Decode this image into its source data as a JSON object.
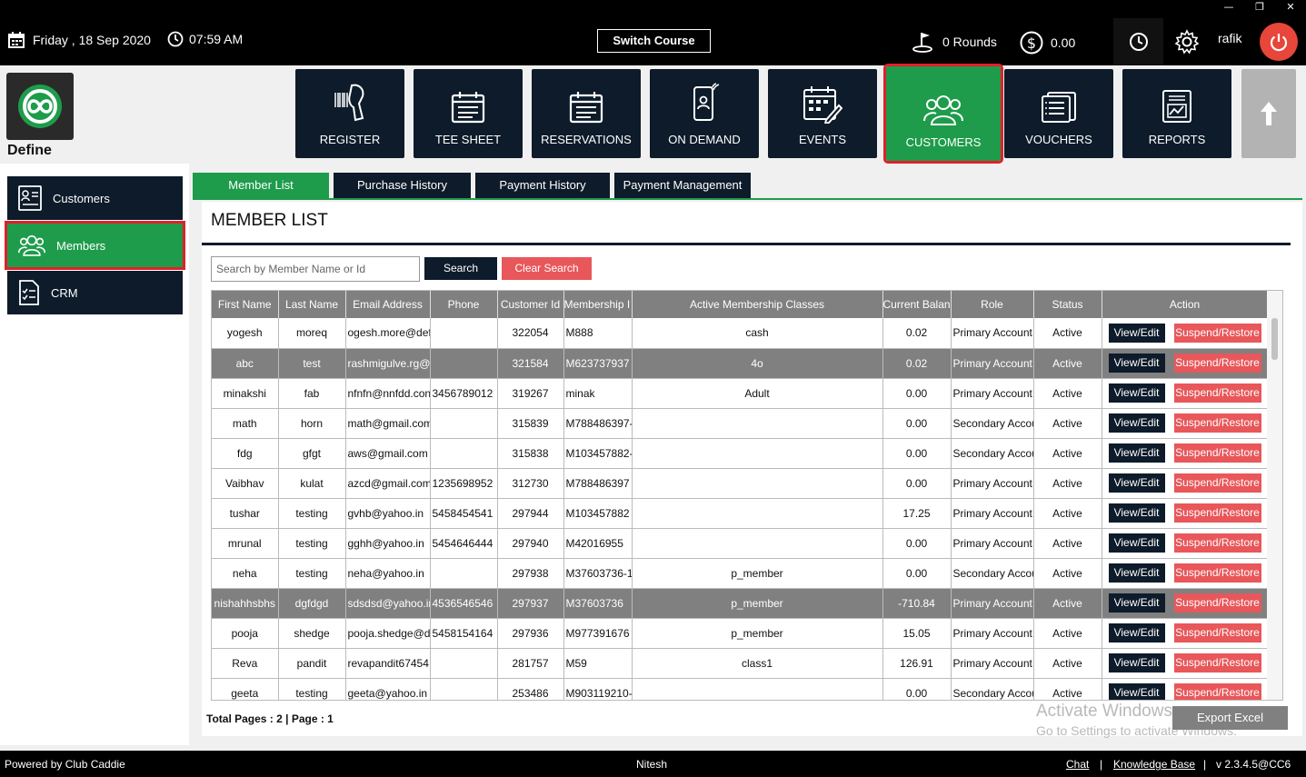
{
  "window_controls": [
    "—",
    "❐",
    "✕"
  ],
  "topbar": {
    "date": "Friday ,  18 Sep 2020",
    "time": "07:59 AM",
    "switch_course": "Switch Course",
    "rounds": "0 Rounds",
    "balance": "0.00",
    "user": "rafik"
  },
  "logo": {
    "label": "Define"
  },
  "nav": [
    {
      "label": "REGISTER",
      "icon": "barcode-scanner-icon"
    },
    {
      "label": "TEE SHEET",
      "icon": "calendar-icon"
    },
    {
      "label": "RESERVATIONS",
      "icon": "calendar-icon"
    },
    {
      "label": "ON DEMAND",
      "icon": "mobile-icon"
    },
    {
      "label": "EVENTS",
      "icon": "calendar-edit-icon"
    },
    {
      "label": "CUSTOMERS",
      "icon": "users-icon",
      "active": true
    },
    {
      "label": "VOUCHERS",
      "icon": "voucher-icon"
    },
    {
      "label": "REPORTS",
      "icon": "report-icon"
    }
  ],
  "sidebar": {
    "items": [
      {
        "label": "Customers",
        "icon": "id-card-icon"
      },
      {
        "label": "Members",
        "icon": "users-icon",
        "active": true
      },
      {
        "label": "CRM",
        "icon": "checklist-icon"
      }
    ]
  },
  "tabs": [
    {
      "label": "Member List",
      "active": true
    },
    {
      "label": "Purchase History"
    },
    {
      "label": "Payment History"
    },
    {
      "label": "Payment Management"
    }
  ],
  "page_title": "MEMBER LIST",
  "search": {
    "placeholder": "Search by Member Name or Id",
    "search_label": "Search",
    "clear_label": "Clear Search"
  },
  "table": {
    "columns": [
      "First Name",
      "Last Name",
      "Email Address",
      "Phone",
      "Customer Id",
      "Membership I",
      "Active Membership Classes",
      "Current Balan",
      "Role",
      "Status",
      "Action"
    ],
    "view_label": "View/Edit",
    "suspend_label": "Suspend/Restore",
    "rows": [
      {
        "first": "yogesh",
        "last": "moreq",
        "email": "ogesh.more@def",
        "phone": "",
        "id": "322054",
        "membership": "M888",
        "classes": "cash",
        "balance": "0.02",
        "role": "Primary Account",
        "status": "Active"
      },
      {
        "first": "abc",
        "last": "test",
        "email": "rashmigulve.rg@",
        "phone": "",
        "id": "321584",
        "membership": "M623737937",
        "classes": "4o",
        "balance": "0.02",
        "role": "Primary Account",
        "status": "Active",
        "selected": true
      },
      {
        "first": "minakshi",
        "last": "fab",
        "email": "nfnfn@nnfdd.con",
        "phone": "3456789012",
        "id": "319267",
        "membership": "minak",
        "classes": "Adult",
        "balance": "0.00",
        "role": "Primary Account",
        "status": "Active"
      },
      {
        "first": "math",
        "last": "horn",
        "email": "math@gmail.com",
        "phone": "",
        "id": "315839",
        "membership": "M788486397-",
        "classes": "",
        "balance": "0.00",
        "role": "Secondary Accou",
        "status": "Active"
      },
      {
        "first": "fdg",
        "last": "gfgt",
        "email": "aws@gmail.com",
        "phone": "",
        "id": "315838",
        "membership": "M103457882-",
        "classes": "",
        "balance": "0.00",
        "role": "Secondary Accou",
        "status": "Active"
      },
      {
        "first": "Vaibhav",
        "last": "kulat",
        "email": "azcd@gmail.com",
        "phone": "1235698952",
        "id": "312730",
        "membership": "M788486397",
        "classes": "",
        "balance": "0.00",
        "role": "Primary Account",
        "status": "Active"
      },
      {
        "first": "tushar",
        "last": "testing",
        "email": "gvhb@yahoo.in",
        "phone": "5458454541",
        "id": "297944",
        "membership": "M103457882",
        "classes": "",
        "balance": "17.25",
        "role": "Primary Account",
        "status": "Active"
      },
      {
        "first": "mrunal",
        "last": "testing",
        "email": "gghh@yahoo.in",
        "phone": "5454646444",
        "id": "297940",
        "membership": "M42016955",
        "classes": "",
        "balance": "0.00",
        "role": "Primary Account",
        "status": "Active"
      },
      {
        "first": "neha",
        "last": "testing",
        "email": "neha@yahoo.in",
        "phone": "",
        "id": "297938",
        "membership": "M37603736-1",
        "classes": "p_member",
        "balance": "0.00",
        "role": "Secondary Accou",
        "status": "Active"
      },
      {
        "first": "nishahhsbhs",
        "last": "dgfdgd",
        "email": "sdsdsd@yahoo.in",
        "phone": "4536546546",
        "id": "297937",
        "membership": "M37603736",
        "classes": "p_member",
        "balance": "-710.84",
        "role": "Primary Account",
        "status": "Active",
        "selected": true
      },
      {
        "first": "pooja",
        "last": "shedge",
        "email": "pooja.shedge@d",
        "phone": "5458154164",
        "id": "297936",
        "membership": "M977391676",
        "classes": "p_member",
        "balance": "15.05",
        "role": "Primary Account",
        "status": "Active"
      },
      {
        "first": "Reva",
        "last": "pandit",
        "email": "revapandit67454",
        "phone": "",
        "id": "281757",
        "membership": "M59",
        "classes": "class1",
        "balance": "126.91",
        "role": "Primary Account",
        "status": "Active"
      },
      {
        "first": "geeta",
        "last": "testing",
        "email": "geeta@yahoo.in",
        "phone": "",
        "id": "253486",
        "membership": "M903119210-",
        "classes": "",
        "balance": "0.00",
        "role": "Secondary Accou",
        "status": "Active"
      }
    ]
  },
  "pagination": "Total Pages : 2 | Page : 1",
  "export_label": "Export Excel",
  "watermark": {
    "line1": "Activate Windows",
    "line2": "Go to Settings to activate Windows."
  },
  "footer": {
    "powered": "Powered by Club Caddie",
    "user": "Nitesh",
    "chat": "Chat",
    "sep1": "|",
    "kb": "Knowledge Base",
    "sep2": "|",
    "version": "v 2.3.4.5@CC6"
  },
  "colors": {
    "navy": "#0d1b2a",
    "green": "#1e9c4b",
    "red": "#e8575a",
    "highlight": "#e0202a",
    "grid_header": "#808080"
  }
}
